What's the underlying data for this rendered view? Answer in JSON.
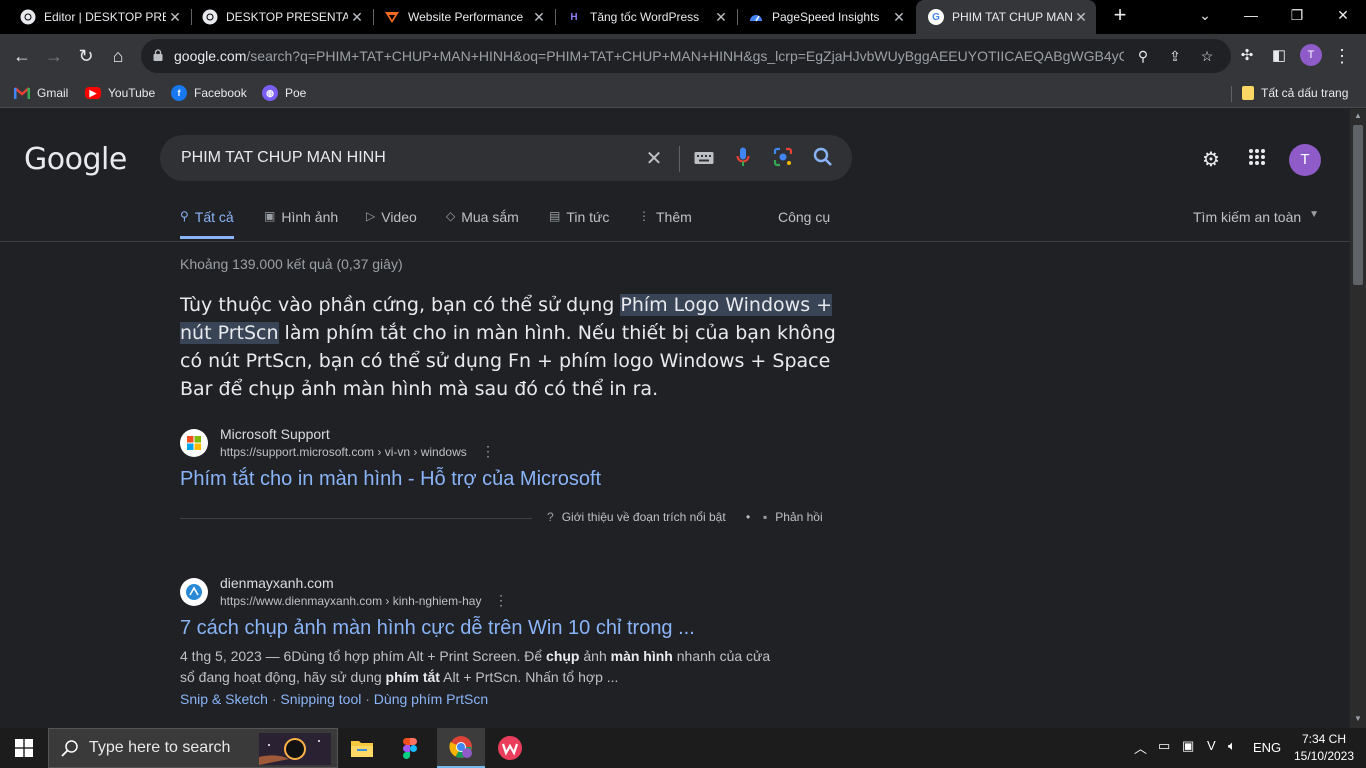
{
  "tabs": [
    {
      "title": "Editor | DESKTOP PRESENTATION",
      "icon": "chrome-icon",
      "active": false
    },
    {
      "title": "DESKTOP PRESENTATION",
      "icon": "chrome-icon",
      "active": false
    },
    {
      "title": "Website Performance",
      "icon": "gtmetrix-icon",
      "active": false
    },
    {
      "title": "Tăng tốc WordPress",
      "icon": "wp-rocket-icon",
      "active": false
    },
    {
      "title": "PageSpeed Insights",
      "icon": "pagespeed-icon",
      "active": false
    },
    {
      "title": "PHIM TAT CHUP MAN HINH - Google Search",
      "icon": "google-icon",
      "active": true
    }
  ],
  "toolbar": {
    "url_domain": "google.com",
    "url_rest": "/search?q=PHIM+TAT+CHUP+MAN+HINH&oq=PHIM+TAT+CHUP+MAN+HINH&gs_lcrp=EgZjaHJvbWUyBggAEEUYOTIICAEQABgWGB4yC...",
    "profile_initial": "T"
  },
  "bookmarks": [
    {
      "label": "Gmail",
      "icon": "gmail-icon"
    },
    {
      "label": "YouTube",
      "icon": "youtube-icon"
    },
    {
      "label": "Facebook",
      "icon": "facebook-icon"
    },
    {
      "label": "Poe",
      "icon": "poe-icon"
    }
  ],
  "all_bookmarks_label": "Tất cả dấu trang",
  "search": {
    "logo": "Google",
    "query": "PHIM TAT CHUP MAN HINH",
    "avatar_initial": "T"
  },
  "nav_tabs": [
    {
      "label": "Tất cả",
      "icon": "search-icon",
      "active": true
    },
    {
      "label": "Hình ảnh",
      "icon": "image-icon"
    },
    {
      "label": "Video",
      "icon": "video-icon"
    },
    {
      "label": "Mua sắm",
      "icon": "tag-icon"
    },
    {
      "label": "Tin tức",
      "icon": "news-icon"
    },
    {
      "label": "Thêm",
      "icon": "more-icon"
    }
  ],
  "tools_label": "Công cụ",
  "safe_search_label": "Tìm kiếm an toàn",
  "result_stats": "Khoảng 139.000 kết quả (0,37 giây)",
  "featured_snippet": {
    "before": "Tùy thuộc vào phần cứng, bạn có thể sử dụng ",
    "highlight": "Phím Logo Windows + nút PrtScn",
    "after": " làm phím tắt cho in màn hình. Nếu thiết bị của bạn không có nút PrtScn, bạn có thể sử dụng Fn + phím logo Windows + Space Bar để chụp ảnh màn hình mà sau đó có thể in ra."
  },
  "featured_source": {
    "site": "Microsoft Support",
    "url": "https://support.microsoft.com › vi-vn › windows",
    "title": "Phím tắt cho in màn hình - Hỗ trợ của Microsoft"
  },
  "feedback": {
    "about": "Giới thiệu về đoạn trích nổi bật",
    "separator": "•",
    "feedback": "Phản hồi"
  },
  "result2": {
    "site": "dienmayxanh.com",
    "url": "https://www.dienmayxanh.com › kinh-nghiem-hay",
    "title": "7 cách chụp ảnh màn hình cực dễ trên Win 10 chỉ trong ...",
    "date": "4 thg 5, 2023 — ",
    "desc_parts": [
      {
        "t": "6Dùng tổ hợp phím Alt + Print Screen. Để ",
        "b": false
      },
      {
        "t": "chụp",
        "b": true
      },
      {
        "t": " ảnh ",
        "b": false
      },
      {
        "t": "màn hình",
        "b": true
      },
      {
        "t": " nhanh của cửa sổ đang hoạt động, hãy sử dụng ",
        "b": false
      },
      {
        "t": "phím tắt",
        "b": true
      },
      {
        "t": " Alt + PrtScn. Nhấn tổ hợp ...",
        "b": false
      }
    ],
    "sitelinks": [
      "Snip & Sketch",
      "Snipping tool",
      "Dùng phím PrtScn"
    ],
    "sitelink_sep": " · "
  },
  "taskbar": {
    "search_placeholder": "Type here to search",
    "lang": "ENG",
    "time": "7:34 CH",
    "date": "15/10/2023"
  }
}
